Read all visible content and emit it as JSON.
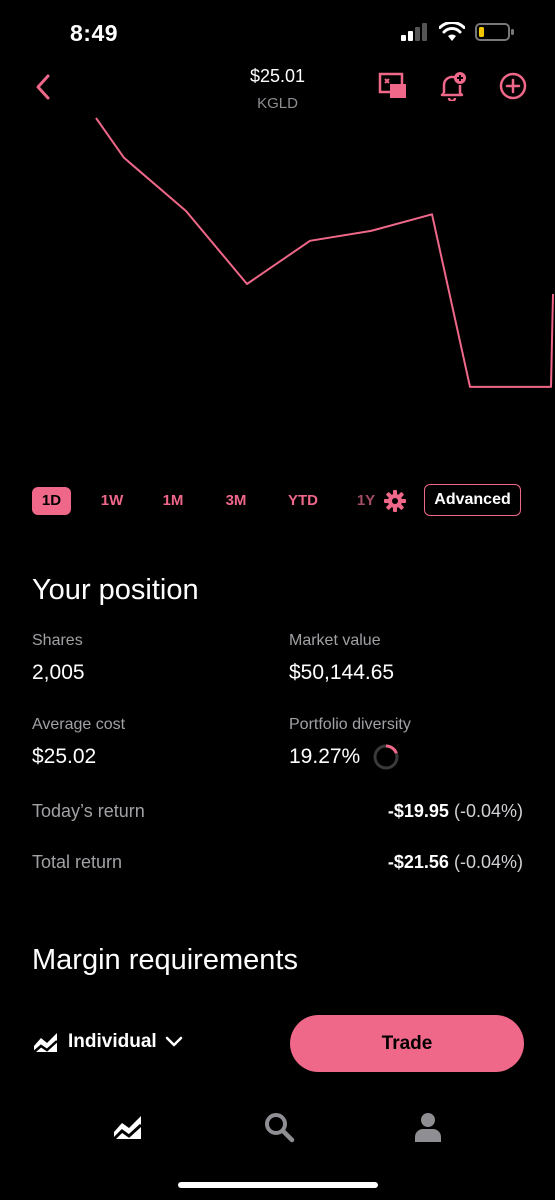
{
  "status": {
    "time": "8:49"
  },
  "nav": {
    "price": "$25.01",
    "ticker": "KGLD"
  },
  "colors": {
    "accent": "#ef6789",
    "background": "#000000",
    "muted": "#a1a1a6"
  },
  "icons": {
    "back": "chevron-left-icon",
    "pip": "picture-in-picture-icon",
    "alert": "bell-add-icon",
    "add": "plus-circle-icon",
    "settings": "gear-icon",
    "account": "chart-icon",
    "dropdown": "chevron-down-icon",
    "tab_home": "chart-icon",
    "tab_search": "search-icon",
    "tab_profile": "person-icon"
  },
  "chart_data": {
    "type": "line",
    "series": [
      {
        "values": [
          100,
          88,
          72,
          50,
          63,
          66,
          71,
          19,
          19,
          19,
          47
        ]
      }
    ],
    "color": "#ef6789",
    "grid": false,
    "axes": false
  },
  "ranges": {
    "items": [
      "1D",
      "1W",
      "1M",
      "3M",
      "YTD",
      "1Y"
    ],
    "active": "1D",
    "advanced_label": "Advanced"
  },
  "position": {
    "title": "Your position",
    "shares_label": "Shares",
    "shares_value": "2,005",
    "market_value_label": "Market value",
    "market_value": "$50,144.65",
    "avg_cost_label": "Average cost",
    "avg_cost_value": "$25.02",
    "diversity_label": "Portfolio diversity",
    "diversity_value": "19.27%",
    "diversity_fraction": 0.1927,
    "today_label": "Today’s return",
    "today_amount": "-$19.95",
    "today_pct": "(-0.04%)",
    "total_label": "Total return",
    "total_amount": "-$21.56",
    "total_pct": "(-0.04%)"
  },
  "margin": {
    "title": "Margin requirements"
  },
  "footer": {
    "account_label": "Individual",
    "trade_label": "Trade"
  }
}
